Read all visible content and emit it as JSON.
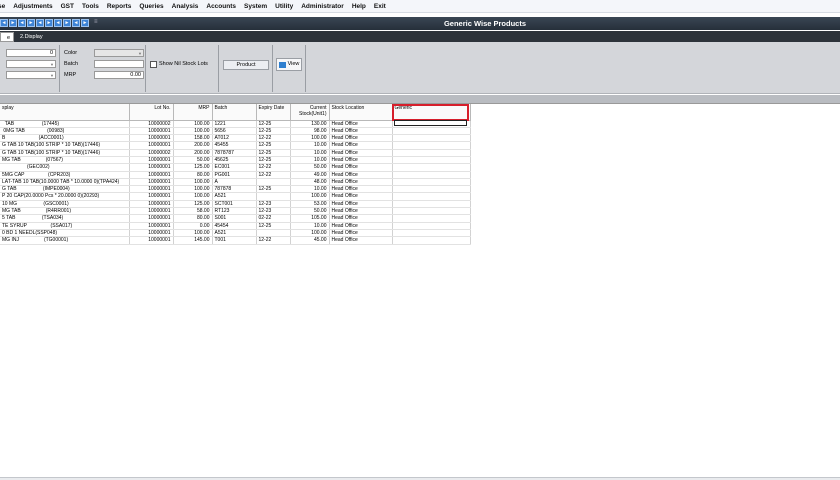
{
  "menu": [
    "se",
    "Adjustments",
    "GST",
    "Tools",
    "Reports",
    "Queries",
    "Analysis",
    "Accounts",
    "System",
    "Utility",
    "Administrator",
    "Help",
    "Exit"
  ],
  "window": {
    "title": "Generic Wise Products",
    "toolbar_glyphs": [
      "◄",
      "►",
      "◄",
      "►",
      "◄",
      "►",
      "◄",
      "►",
      "◄",
      "►"
    ],
    "toolbar_sep": "≡"
  },
  "tabs": [
    {
      "label": "e"
    },
    {
      "label": "2.Display"
    }
  ],
  "filters": {
    "qty_value": "0",
    "color_label": "Color",
    "batch_label": "Batch",
    "mrp_label": "MRP",
    "mrp_value": "0.00",
    "show_nil_label": "Show Nil Stock Lots",
    "product_button": "Product",
    "view_button": "View"
  },
  "table": {
    "columns": [
      "splay",
      "Lot No.",
      "MRP",
      "Batch",
      "Expiry Date",
      "Current Stock(Unit1)",
      "Stock Location",
      "Generic"
    ],
    "rows": [
      [
        "  TAB                    (17445)",
        "10000002",
        "100.00",
        "1221",
        "12-25",
        "130.00",
        "Head Office",
        ""
      ],
      [
        " 0MG TAB                (00983)",
        "10000001",
        "100.00",
        "5656",
        "12-25",
        "98.00",
        "Head Office",
        ""
      ],
      [
        "B                        (ACC0001)",
        "10000001",
        "158.00",
        "AT012",
        "12-22",
        "100.00",
        "Head Office",
        ""
      ],
      [
        "G TAB 10 TAB(100 STRIP * 10 TAB)(17446)",
        "10000001",
        "200.00",
        "45455",
        "12-25",
        "10.00",
        "Head Office",
        ""
      ],
      [
        "G TAB 10 TAB(100 STRIP * 10 TAB)(17446)",
        "10000002",
        "200.00",
        "7878787",
        "12-25",
        "10.00",
        "Head Office",
        ""
      ],
      [
        "MG TAB                  (07567)",
        "10000001",
        "50.00",
        "45625",
        "12-25",
        "10.00",
        "Head Office",
        ""
      ],
      [
        "                  (GEC002)",
        "10000001",
        "125.00",
        "EC001",
        "12-22",
        "50.00",
        "Head Office",
        ""
      ],
      [
        "5MG CAP                 (CPR203)",
        "10000001",
        "80.00",
        "PG001",
        "12-22",
        "49.00",
        "Head Office",
        ""
      ],
      [
        "LAT-TAB 10 TAB(10.0000 TAB * 10.0000 0)(TPA424)",
        "10000001",
        "100.00",
        "A",
        "",
        "48.00",
        "Head Office",
        ""
      ],
      [
        "G TAB                   (IMPE0004)",
        "10000001",
        "100.00",
        "787878",
        "12-25",
        "10.00",
        "Head Office",
        ""
      ],
      [
        "P 20 CAP(20.0000 Pcs * 20.0000 0)(20293)",
        "10000001",
        "100.00",
        "A521",
        "",
        "100.00",
        "Head Office",
        ""
      ],
      [
        "10 MG                   (GSC0001)",
        "10000001",
        "125.00",
        "SCT001",
        "12-23",
        "53.00",
        "Head Office",
        ""
      ],
      [
        "MG TAB                  (R4RR001)",
        "10000001",
        "58.00",
        "RT123",
        "12-23",
        "50.00",
        "Head Office",
        ""
      ],
      [
        "5 TAB                   (TSA034)",
        "10000001",
        "80.00",
        "S001",
        "02-22",
        "105.00",
        "Head Office",
        ""
      ],
      [
        "TE SYRUP                 (SSA017)",
        "10000001",
        "0.00",
        "45454",
        "12-25",
        "10.00",
        "Head Office",
        ""
      ],
      [
        "0 BD 1 NEEDL(SSP048)",
        "10000001",
        "100.00",
        "A521",
        "",
        "100.00",
        "Head Office",
        ""
      ],
      [
        "MG INJ                  (TG00001)",
        "10000001",
        "145.00",
        "T001",
        "12-22",
        "45.00",
        "Head Office",
        ""
      ]
    ]
  }
}
